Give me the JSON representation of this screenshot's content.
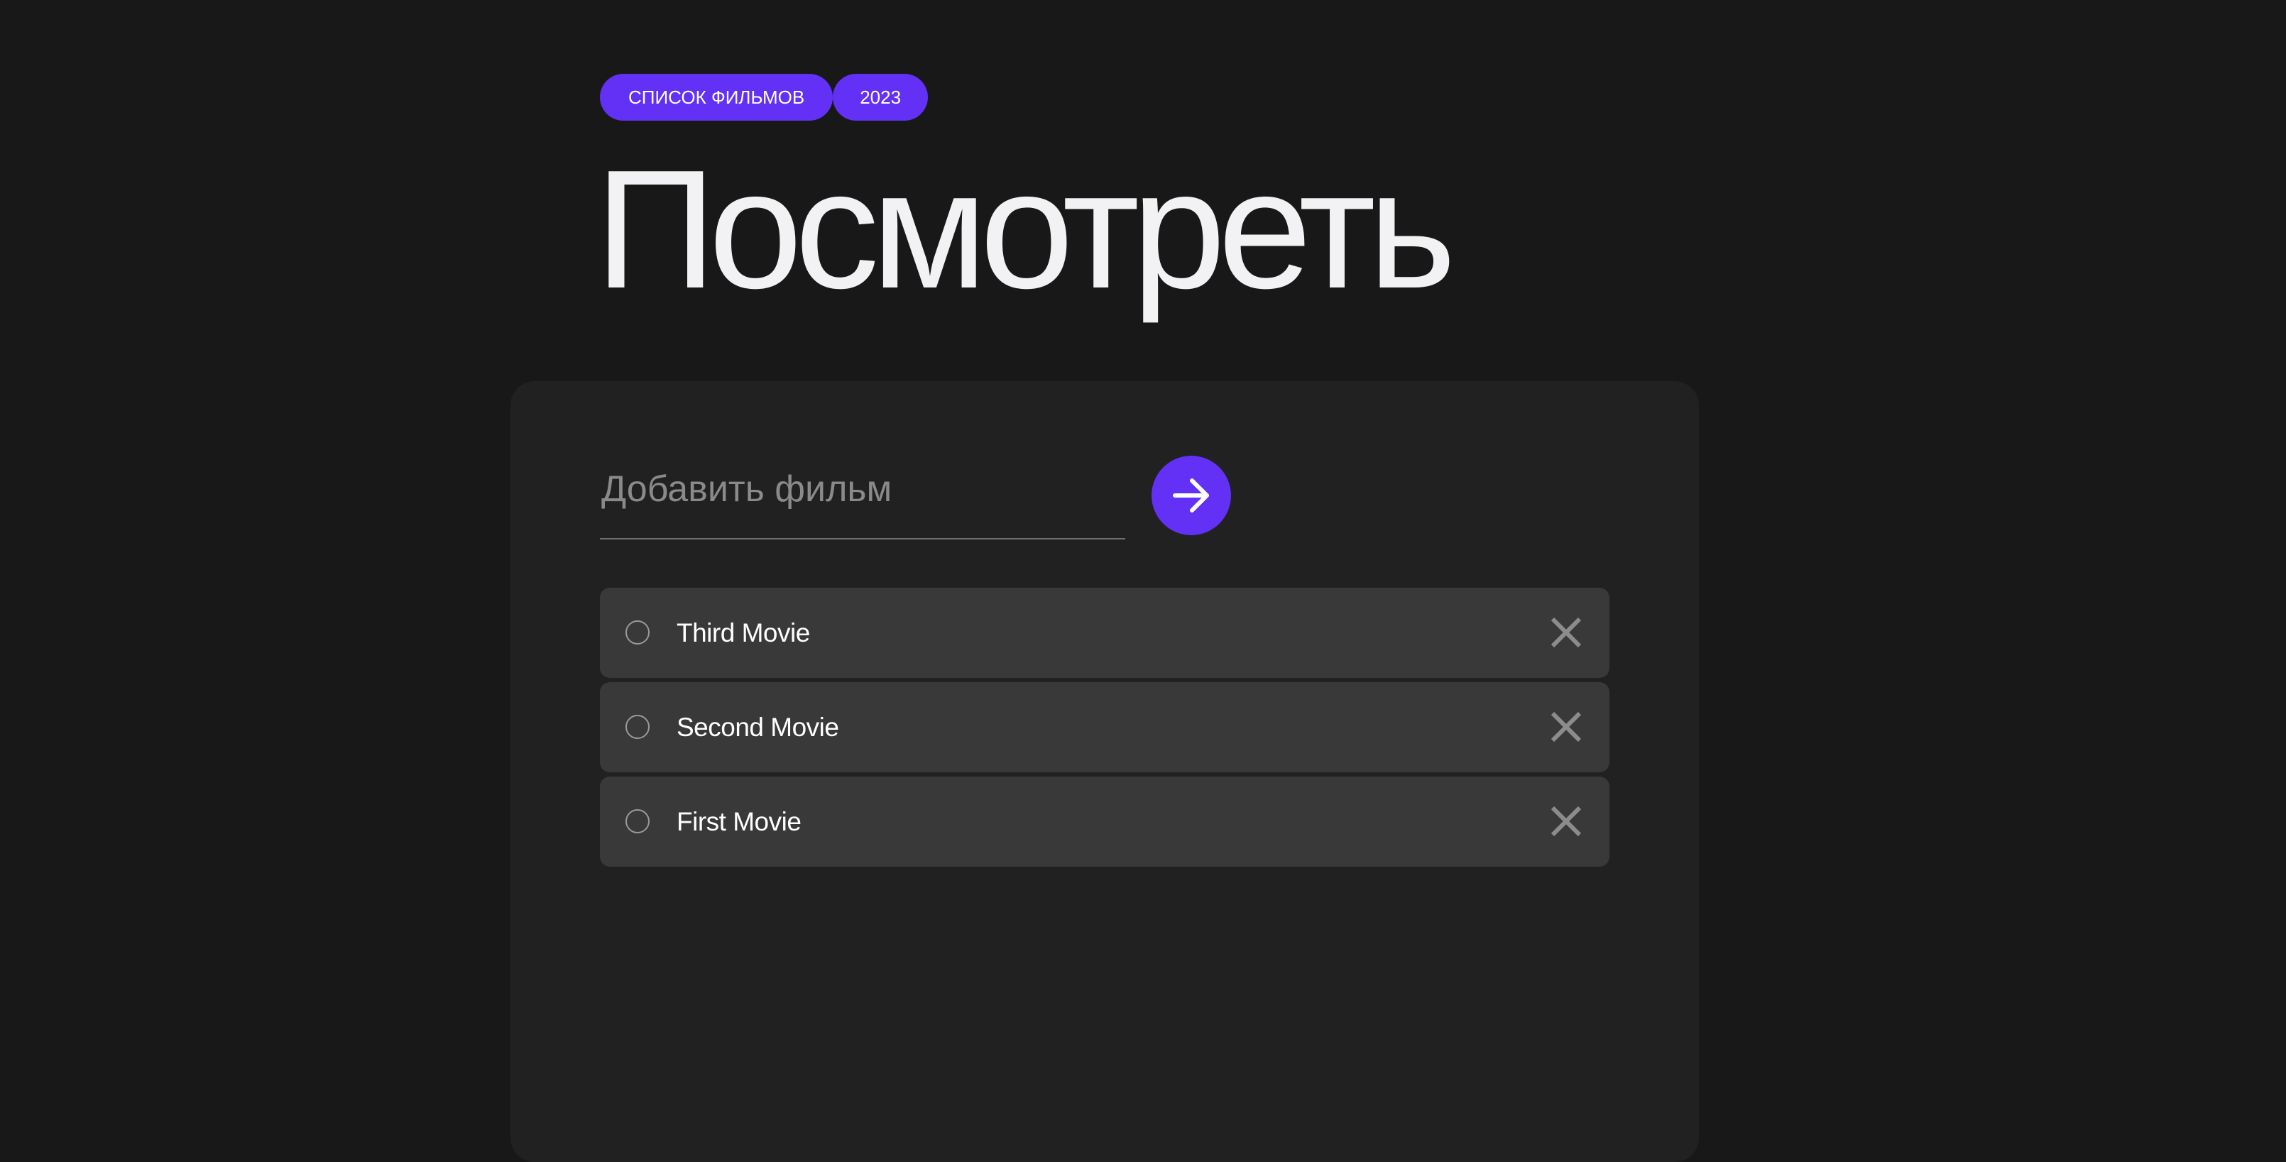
{
  "header": {
    "tags": [
      {
        "label": "СПИСОК ФИЛЬМОВ"
      },
      {
        "label": "2023"
      }
    ],
    "title": "Посмотреть"
  },
  "form": {
    "input_value": "",
    "placeholder": "Добавить фильм",
    "submit_icon": "arrow-right-icon"
  },
  "movies": [
    {
      "title": "Third Movie",
      "checked": false,
      "delete_icon": "close-icon"
    },
    {
      "title": "Second Movie",
      "checked": false,
      "delete_icon": "close-icon"
    },
    {
      "title": "First Movie",
      "checked": false,
      "delete_icon": "close-icon"
    }
  ],
  "colors": {
    "background": "#181818",
    "panel": "#212121",
    "item": "#393939",
    "accent": "#6231f5",
    "text": "#ffffff",
    "muted": "#8a8a8a"
  }
}
